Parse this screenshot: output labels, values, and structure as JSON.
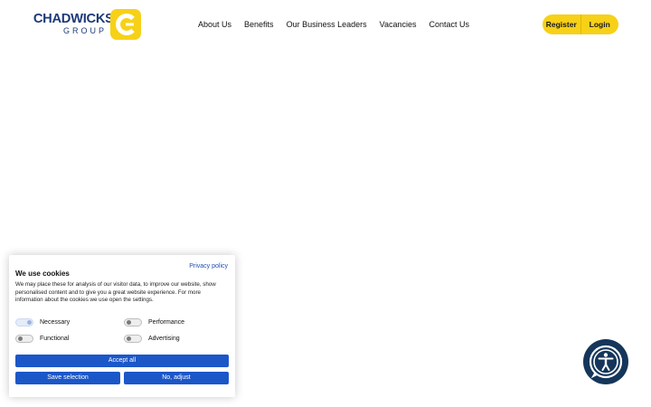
{
  "brand": {
    "name": "CHADWICKS",
    "sub": "GROUP",
    "primary_color": "#1d3a78",
    "accent_color": "#f7d117"
  },
  "nav": {
    "items": [
      {
        "label": "About Us"
      },
      {
        "label": "Benefits"
      },
      {
        "label": "Our Business Leaders"
      },
      {
        "label": "Vacancies"
      },
      {
        "label": "Contact Us"
      }
    ]
  },
  "auth": {
    "register": "Register",
    "login": "Login"
  },
  "cookie": {
    "privacy_link": "Privacy policy",
    "title": "We use cookies",
    "description": "We may place these for analysis of our visitor data, to improve our website, show personalised content and to give you a great website experience. For more information about the cookies we use open the settings.",
    "toggles": [
      {
        "label": "Necessary",
        "state": "on"
      },
      {
        "label": "Performance",
        "state": "off"
      },
      {
        "label": "Functional",
        "state": "off"
      },
      {
        "label": "Advertising",
        "state": "off"
      }
    ],
    "accept_all": "Accept all",
    "save_selection": "Save selection",
    "no_adjust": "No, adjust",
    "button_color": "#1c57c8"
  },
  "accessibility": {
    "icon": "accessibility-icon",
    "color": "#15365a"
  }
}
